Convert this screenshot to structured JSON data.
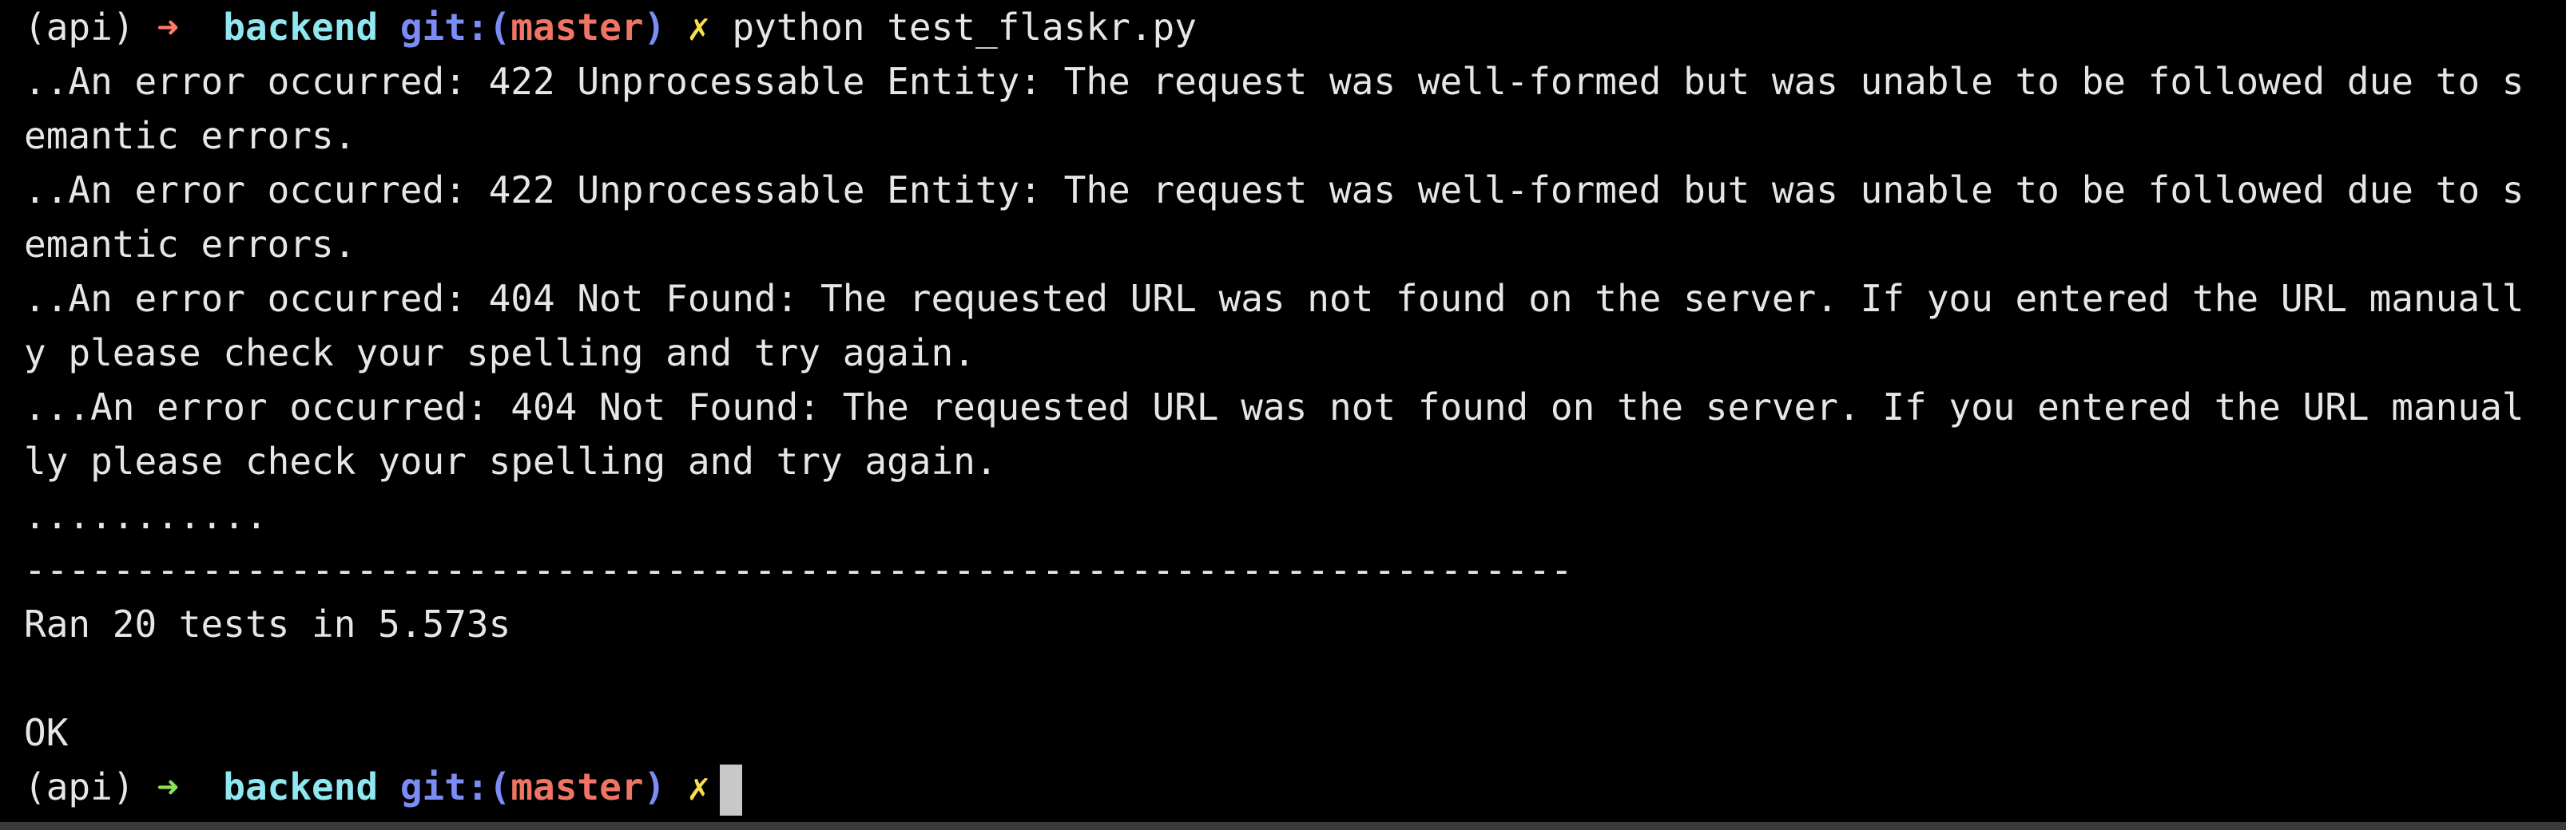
{
  "colors": {
    "background": "#000000",
    "text": "#e6e6e6",
    "arrow_error": "#ff7a6a",
    "arrow_success": "#8ee05a",
    "directory": "#8fe7f0",
    "git_label": "#7b8cf5",
    "git_branch": "#f07464",
    "dirty_marker": "#f7df4e",
    "cursor": "#c8c8c8"
  },
  "prompt_first": {
    "env": "(api)",
    "arrow": "➜",
    "directory": "backend",
    "git_prefix": "git:(",
    "branch": "master",
    "git_suffix": ")",
    "dirty": "✗",
    "command": "python test_flaskr.py"
  },
  "output_lines": [
    "..An error occurred: 422 Unprocessable Entity: The request was well-formed but was unable to be followed due to s",
    "emantic errors.",
    "..An error occurred: 422 Unprocessable Entity: The request was well-formed but was unable to be followed due to s",
    "emantic errors.",
    "..An error occurred: 404 Not Found: The requested URL was not found on the server. If you entered the URL manuall",
    "y please check your spelling and try again.",
    "...An error occurred: 404 Not Found: The requested URL was not found on the server. If you entered the URL manual",
    "ly please check your spelling and try again.",
    "...........",
    "----------------------------------------------------------------------",
    "Ran 20 tests in 5.573s",
    "",
    "OK"
  ],
  "prompt_last": {
    "env": "(api)",
    "arrow": "➜",
    "directory": "backend",
    "git_prefix": "git:(",
    "branch": "master",
    "git_suffix": ")",
    "dirty": "✗"
  }
}
